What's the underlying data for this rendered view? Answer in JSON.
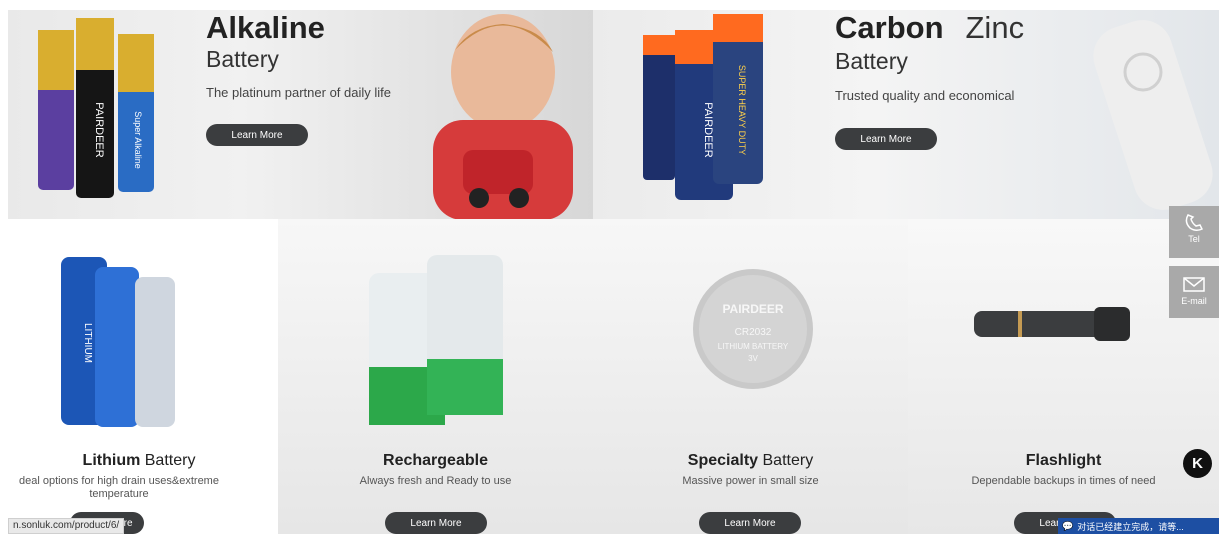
{
  "hero_left": {
    "title_bold": "Alkaline",
    "subtitle": "Battery",
    "tagline": "The platinum partner of daily life",
    "button": "Learn More",
    "battery_brand": "PAIRDEER",
    "battery_variant": "Super Alkaline"
  },
  "hero_right": {
    "title_bold": "Carbon",
    "title_light": "Zinc",
    "subtitle": "Battery",
    "tagline": "Trusted quality and economical",
    "button": "Learn More",
    "battery_brand": "PAIRDEER",
    "battery_variant": "SUPER HEAVY DUTY"
  },
  "cards": [
    {
      "title_bold": "Lithium",
      "title_light": " Battery",
      "desc": "deal options for high drain uses&extreme temperature",
      "button": "Learn More",
      "label": "LITHIUM"
    },
    {
      "title_bold": "Rechargeable",
      "title_light": "",
      "desc": "Always fresh and Ready to use",
      "button": "Learn More"
    },
    {
      "title_bold": "Specialty",
      "title_light": " Battery",
      "desc": "Massive power in small size",
      "button": "Learn More",
      "coin": {
        "brand": "PAIRDEER",
        "model": "CR2032",
        "type": "LITHIUM BATTERY",
        "volt": "3V"
      }
    },
    {
      "title_bold": "Flashlight",
      "title_light": "",
      "desc": "Dependable backups in times of need",
      "button": "Learn More"
    }
  ],
  "side_contact": {
    "tel": "Tel",
    "email": "E-mail"
  },
  "status_url": "n.sonluk.com/product/6/",
  "chat_text": "对话已经建立完成，请等...",
  "floating_logo": "K"
}
